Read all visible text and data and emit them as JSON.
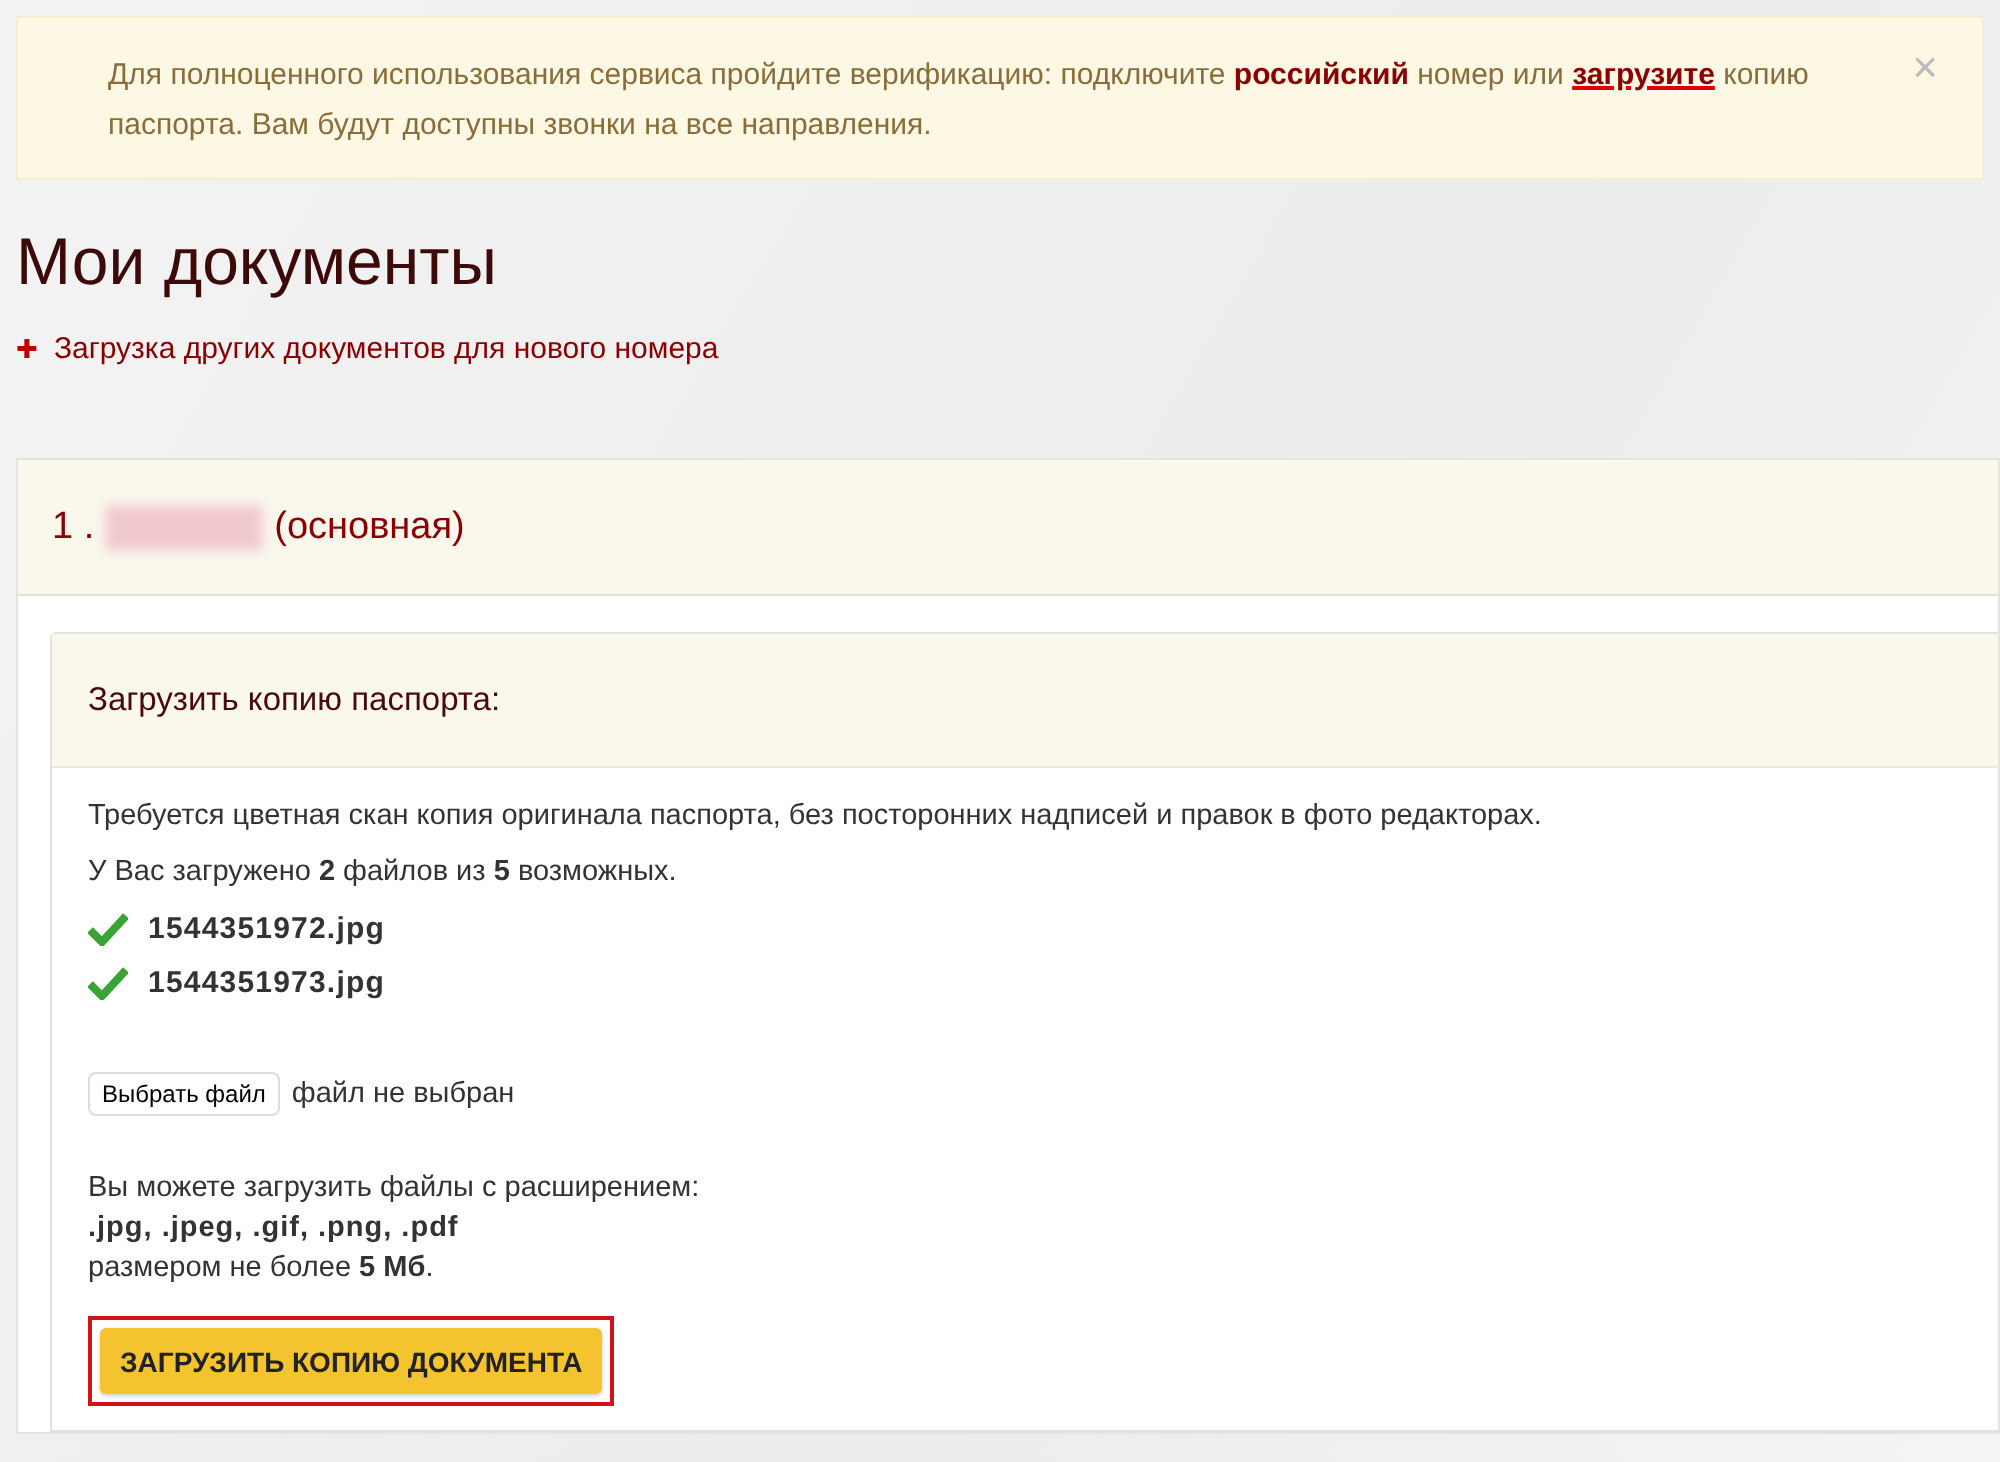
{
  "alert": {
    "parts": [
      {
        "kind": "text",
        "text": "Для полноценного использования сервиса пройдите верификацию: подключите "
      },
      {
        "kind": "strong-link",
        "text": "российский"
      },
      {
        "kind": "text",
        "text": " номер или "
      },
      {
        "kind": "underline-link",
        "text": "загрузите"
      },
      {
        "kind": "text",
        "text": " копию паспорта. Вам будут доступны звонки на все направления."
      }
    ],
    "close": "×"
  },
  "page_title": "Мои документы",
  "add_link": {
    "icon": "✚",
    "label": "Загрузка других документов для нового номера"
  },
  "number_card": {
    "index": "1 .",
    "suffix": "(основная)",
    "panel": {
      "title": "Загрузить копию паспорта:",
      "requirement": "Требуется цветная скан копия оригинала паспорта, без посторонних надписей и правок в фото редакторах.",
      "count_text": "У Вас загружено **2** файлов из **5** возможных.",
      "files": [
        {
          "name": "1544351972.jpg",
          "uploaded": true
        },
        {
          "name": "1544351973.jpg",
          "uploaded": true
        }
      ],
      "file_picker": {
        "button": "Выбрать файл",
        "status": "файл не выбран"
      },
      "formats_intro": "Вы можете загрузить файлы с расширением:",
      "formats": ".jpg, .jpeg, .gif, .png, .pdf",
      "size_text": "размером не более **5 Мб**.",
      "upload_button": {
        "label": "ЗАГРУЗИТЬ КОПИЮ ДОКУМЕНТА",
        "highlighted": true
      }
    }
  }
}
